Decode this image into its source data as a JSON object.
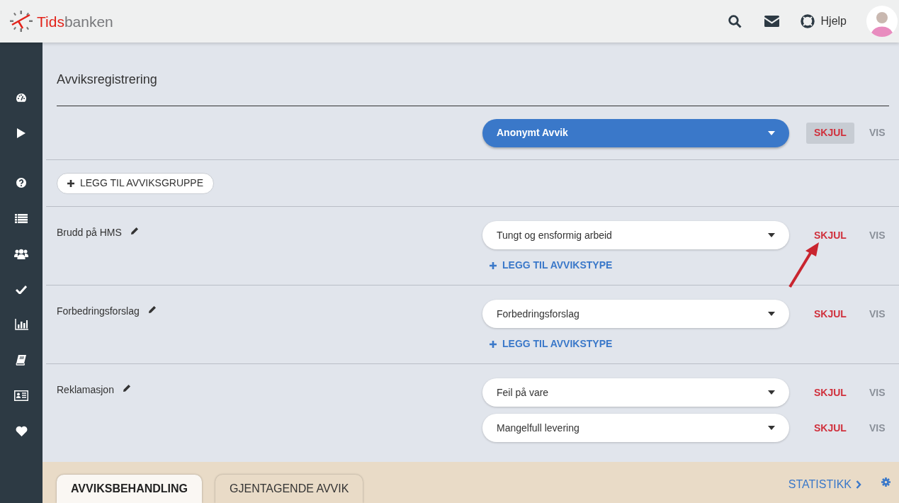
{
  "header": {
    "logo": {
      "part_1": "Tids",
      "part_2": "banken"
    },
    "help_label": "Hjelp"
  },
  "sidebar": {
    "items": [
      {
        "kind": "dashboard"
      },
      {
        "kind": "play"
      },
      {
        "kind": "help"
      },
      {
        "kind": "list"
      },
      {
        "kind": "users"
      },
      {
        "kind": "check"
      },
      {
        "kind": "chart"
      },
      {
        "kind": "book"
      },
      {
        "kind": "card"
      },
      {
        "kind": "heart"
      }
    ]
  },
  "page": {
    "title": "Avviksregistrering",
    "anonymous": {
      "dropdown": "Anonymt Avvik",
      "options": [
        {
          "label": "SKJUL",
          "selected": true
        },
        {
          "label": "VIS",
          "selected": false
        }
      ]
    },
    "add_group_button": "LEGG TIL AVVIKSGRUPPE",
    "groups": [
      {
        "name": "Brudd på HMS",
        "types": [
          {
            "label": "Tungt og ensformig arbeid",
            "options": [
              {
                "label": "SKJUL",
                "selected": false
              },
              {
                "label": "VIS",
                "selected": false
              }
            ]
          }
        ],
        "add_type": "LEGG TIL AVVIKSTYPE"
      },
      {
        "name": "Forbedringsforslag",
        "types": [
          {
            "label": "Forbedringsforslag",
            "options": [
              {
                "label": "SKJUL",
                "selected": false
              },
              {
                "label": "VIS",
                "selected": false
              }
            ]
          }
        ],
        "add_type": "LEGG TIL AVVIKSTYPE"
      },
      {
        "name": "Reklamasjon",
        "types": [
          {
            "label": "Feil på vare",
            "options": [
              {
                "label": "SKJUL",
                "selected": false
              },
              {
                "label": "VIS",
                "selected": false
              }
            ]
          },
          {
            "label": "Mangelfull levering",
            "options": [
              {
                "label": "SKJUL",
                "selected": false
              },
              {
                "label": "VIS",
                "selected": false
              }
            ]
          }
        ]
      }
    ]
  },
  "annotation": {
    "kind": "arrow"
  },
  "footer": {
    "tabs": [
      {
        "label": "AVVIKSBEHANDLING",
        "selected": true
      },
      {
        "label": "GJENTAGENDE AVVIK",
        "selected": false
      }
    ],
    "statistics_link": "STATISTIKK"
  }
}
